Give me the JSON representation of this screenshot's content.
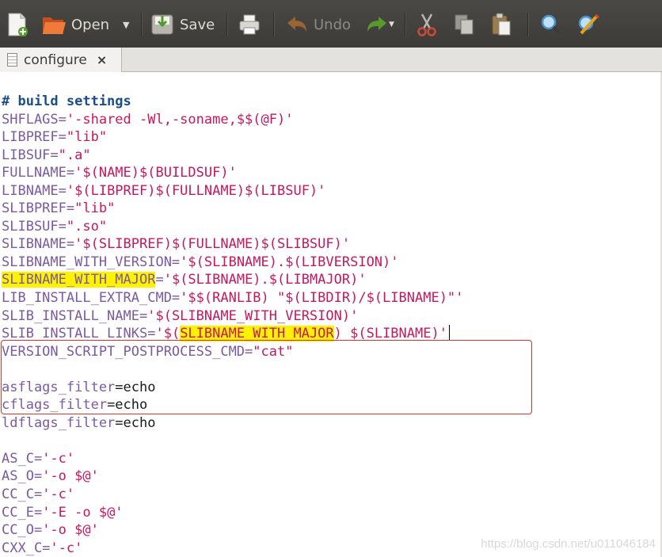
{
  "toolbar": {
    "open_label": "Open",
    "save_label": "Save",
    "undo_label": "Undo"
  },
  "tab": {
    "title": "configure",
    "close": "×"
  },
  "watermark": "https://blog.csdn.net/u011046184",
  "code_lines": [
    [
      {
        "t": "# build settings",
        "c": "c"
      }
    ],
    [
      {
        "t": "SHFLAGS=",
        "c": "k"
      },
      {
        "t": "'-shared -Wl,-soname,$$(@F)'",
        "c": "s"
      }
    ],
    [
      {
        "t": "LIBPREF=",
        "c": "k"
      },
      {
        "t": "\"lib\"",
        "c": "s"
      }
    ],
    [
      {
        "t": "LIBSUF=",
        "c": "k"
      },
      {
        "t": "\".a\"",
        "c": "s"
      }
    ],
    [
      {
        "t": "FULLNAME=",
        "c": "k"
      },
      {
        "t": "'$(NAME)$(BUILDSUF)'",
        "c": "s"
      }
    ],
    [
      {
        "t": "LIBNAME=",
        "c": "k"
      },
      {
        "t": "'$(LIBPREF)$(FULLNAME)$(LIBSUF)'",
        "c": "s"
      }
    ],
    [
      {
        "t": "SLIBPREF=",
        "c": "k"
      },
      {
        "t": "\"lib\"",
        "c": "s"
      }
    ],
    [
      {
        "t": "SLIBSUF=",
        "c": "k"
      },
      {
        "t": "\".so\"",
        "c": "s"
      }
    ],
    [
      {
        "t": "SLIBNAME=",
        "c": "k"
      },
      {
        "t": "'$(SLIBPREF)$(FULLNAME)$(SLIBSUF)'",
        "c": "s"
      }
    ],
    [
      {
        "t": "SLIBNAME_WITH_VERSION=",
        "c": "k"
      },
      {
        "t": "'$(SLIBNAME).$(LIBVERSION)'",
        "c": "s"
      }
    ],
    [
      {
        "t": "SLIBNAME_WITH_MAJOR",
        "c": "k",
        "hl": true
      },
      {
        "t": "=",
        "c": "k"
      },
      {
        "t": "'$(SLIBNAME).$(LIBMAJOR)'",
        "c": "s"
      }
    ],
    [
      {
        "t": "LIB_INSTALL_EXTRA_CMD=",
        "c": "k"
      },
      {
        "t": "'$$(RANLIB) \"$(LIBDIR)/$(LIBNAME)\"'",
        "c": "s"
      }
    ],
    [
      {
        "t": "SLIB_INSTALL_NAME=",
        "c": "k"
      },
      {
        "t": "'$(SLIBNAME_WITH_VERSION)'",
        "c": "s"
      }
    ],
    [
      {
        "t": "SLIB_INSTALL_LINKS=",
        "c": "k"
      },
      {
        "t": "'$(",
        "c": "s"
      },
      {
        "t": "SLIBNAME_WITH_MAJOR",
        "c": "s",
        "hl": true
      },
      {
        "t": ") $(SLIBNAME)'",
        "c": "s"
      },
      {
        "cursor": true
      }
    ],
    [
      {
        "t": "VERSION_SCRIPT_POSTPROCESS_CMD=",
        "c": "k"
      },
      {
        "t": "\"cat\"",
        "c": "s"
      }
    ],
    [],
    [
      {
        "t": "asflags_filter",
        "c": "k"
      },
      {
        "t": "=echo",
        "c": "p"
      }
    ],
    [
      {
        "t": "cflags_filter",
        "c": "k"
      },
      {
        "t": "=echo",
        "c": "p"
      }
    ],
    [
      {
        "t": "ldflags_filter",
        "c": "k"
      },
      {
        "t": "=echo",
        "c": "p"
      }
    ],
    [],
    [
      {
        "t": "AS_C=",
        "c": "k"
      },
      {
        "t": "'-c'",
        "c": "s"
      }
    ],
    [
      {
        "t": "AS_O=",
        "c": "k"
      },
      {
        "t": "'-o $@'",
        "c": "s"
      }
    ],
    [
      {
        "t": "CC_C=",
        "c": "k"
      },
      {
        "t": "'-c'",
        "c": "s"
      }
    ],
    [
      {
        "t": "CC_E=",
        "c": "k"
      },
      {
        "t": "'-E -o $@'",
        "c": "s"
      }
    ],
    [
      {
        "t": "CC_O=",
        "c": "k"
      },
      {
        "t": "'-o $@'",
        "c": "s"
      }
    ],
    [
      {
        "t": "CXX_C=",
        "c": "k"
      },
      {
        "t": "'-c'",
        "c": "s"
      }
    ]
  ]
}
